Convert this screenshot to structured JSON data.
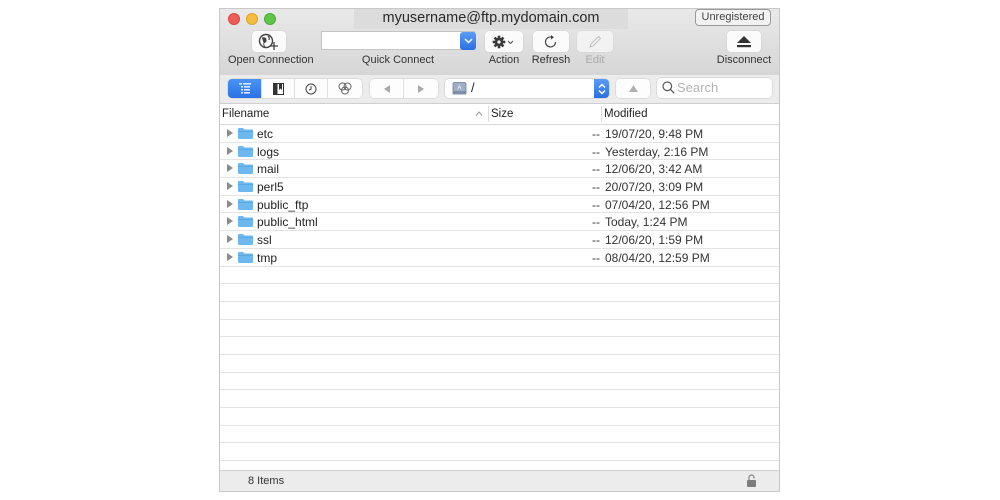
{
  "window": {
    "title": "myusername@ftp.mydomain.com",
    "badge": "Unregistered"
  },
  "toolbar": {
    "open_connection": {
      "label": "Open Connection",
      "icon": "globe-plus-icon"
    },
    "quick_connect": {
      "label": "Quick Connect",
      "value": "",
      "icon": "chevron-down-icon"
    },
    "action": {
      "label": "Action",
      "icon": "gear-icon"
    },
    "refresh": {
      "label": "Refresh",
      "icon": "refresh-icon"
    },
    "edit": {
      "label": "Edit",
      "icon": "pencil-icon",
      "disabled": true
    },
    "disconnect": {
      "label": "Disconnect",
      "icon": "eject-icon"
    }
  },
  "navbar": {
    "view_tabs": [
      {
        "name": "browser",
        "icon": "outline-view-icon",
        "active": true
      },
      {
        "name": "bookmarks",
        "icon": "bookmark-icon",
        "active": false
      },
      {
        "name": "history",
        "icon": "clock-icon",
        "active": false
      },
      {
        "name": "bonjour",
        "icon": "bonjour-icon",
        "active": false
      }
    ],
    "back_icon": "back-arrow-icon",
    "forward_icon": "forward-arrow-icon",
    "path": "/",
    "up_icon": "up-arrow-icon",
    "search_placeholder": "Search",
    "search_value": ""
  },
  "columns": {
    "filename": "Filename",
    "size": "Size",
    "modified": "Modified",
    "sort_indicator": "^"
  },
  "files": [
    {
      "name": "etc",
      "size": "--",
      "modified": "19/07/20, 9:48 PM"
    },
    {
      "name": "logs",
      "size": "--",
      "modified": "Yesterday, 2:16 PM"
    },
    {
      "name": "mail",
      "size": "--",
      "modified": "12/06/20, 3:42 AM"
    },
    {
      "name": "perl5",
      "size": "--",
      "modified": "20/07/20, 3:09 PM"
    },
    {
      "name": "public_ftp",
      "size": "--",
      "modified": "07/04/20, 12:56 PM"
    },
    {
      "name": "public_html",
      "size": "--",
      "modified": "Today, 1:24 PM"
    },
    {
      "name": "ssl",
      "size": "--",
      "modified": "12/06/20, 1:59 PM"
    },
    {
      "name": "tmp",
      "size": "--",
      "modified": "08/04/20, 12:59 PM"
    }
  ],
  "status": {
    "items": "8 Items",
    "lock_icon": "unlocked-padlock-icon"
  },
  "colors": {
    "accent": "#2a72e6",
    "folder": "#6cb8ef",
    "close": "#ee5e57",
    "minimize": "#f6bd3b",
    "maximize": "#5fc649"
  }
}
